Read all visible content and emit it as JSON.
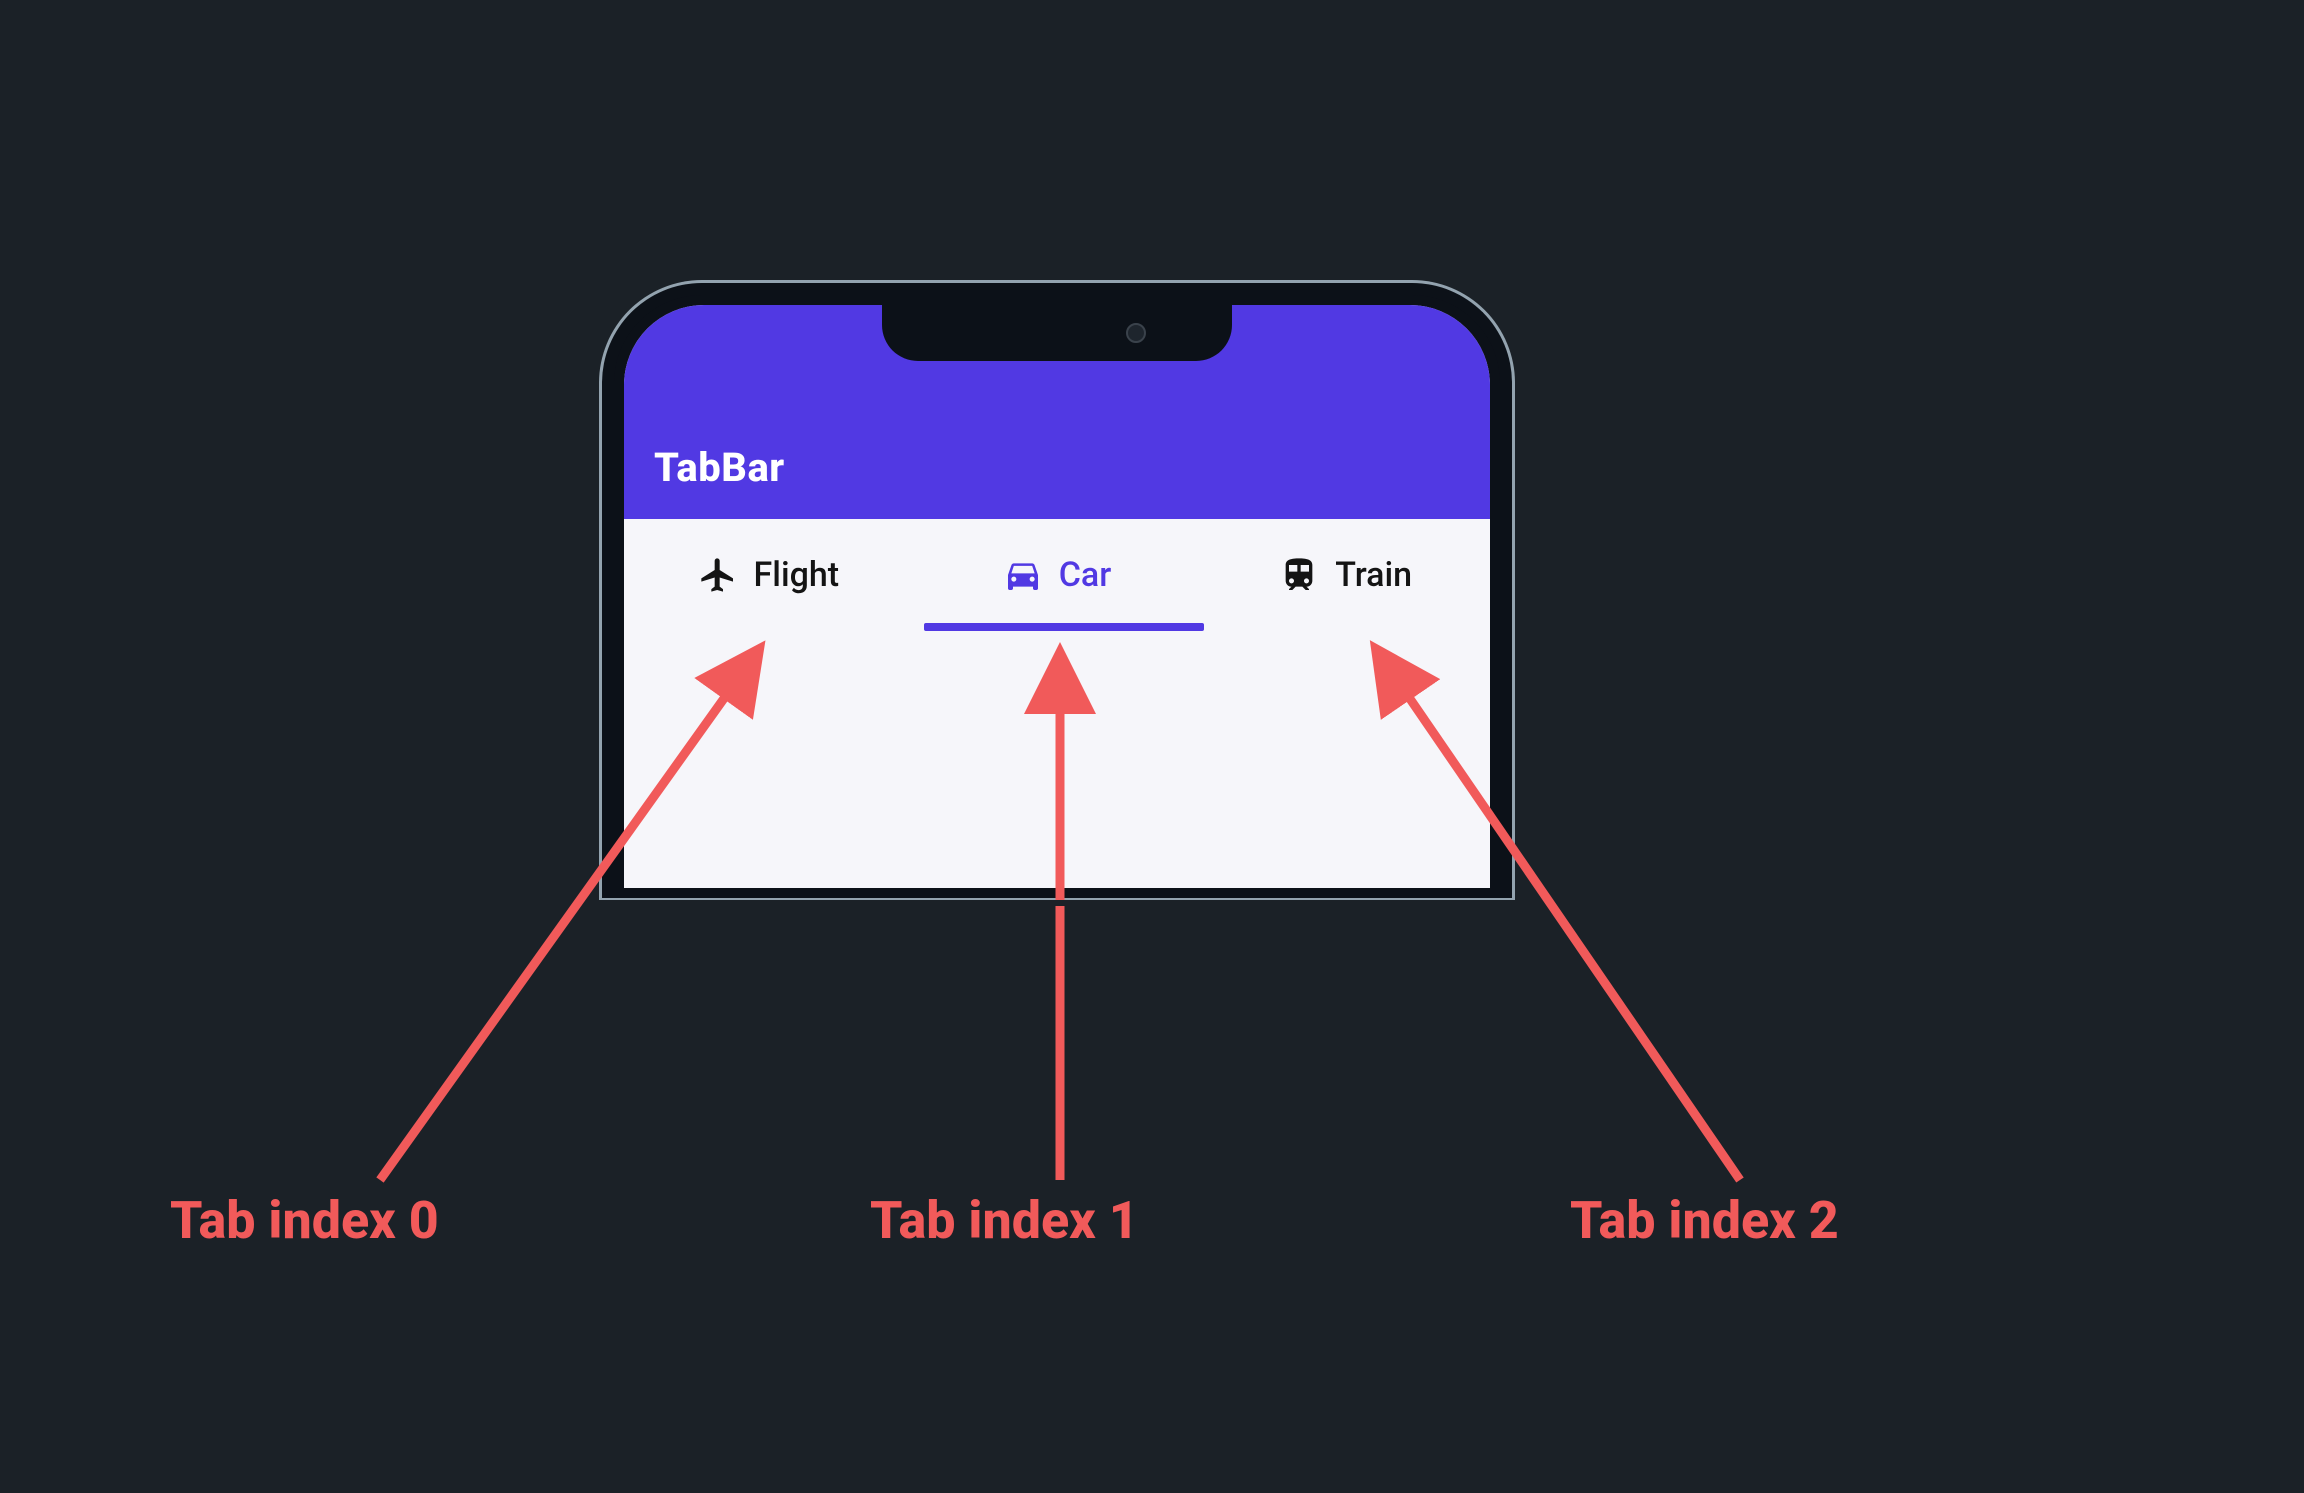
{
  "colors": {
    "background": "#1b2127",
    "accent": "#5139e3",
    "annotation": "#f15a5a",
    "phone_frame": "#0c1118",
    "phone_edge": "#93a3af",
    "screen_bg": "#f6f6fa",
    "ink": "#141414"
  },
  "appbar": {
    "title": "TabBar"
  },
  "tabs": [
    {
      "label": "Flight",
      "icon": "airplane-icon",
      "active": false,
      "index": 0
    },
    {
      "label": "Car",
      "icon": "car-icon",
      "active": true,
      "index": 1
    },
    {
      "label": "Train",
      "icon": "train-icon",
      "active": false,
      "index": 2
    }
  ],
  "annotations": [
    {
      "label": "Tab index 0",
      "points_to_tab_index": 0
    },
    {
      "label": "Tab index 1",
      "points_to_tab_index": 1
    },
    {
      "label": "Tab index 2",
      "points_to_tab_index": 2
    }
  ]
}
